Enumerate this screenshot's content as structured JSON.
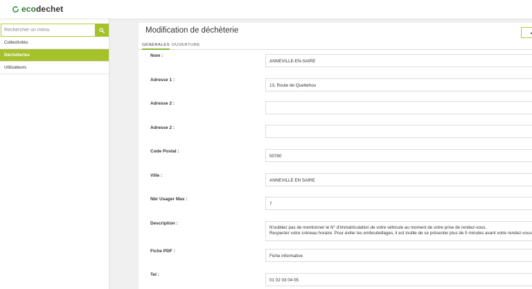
{
  "app": {
    "logo_prefix": "eco",
    "logo_suffix": "dechet",
    "accent": "#a6c22a",
    "logo_color": "#2d7a2d"
  },
  "sidebar": {
    "search_placeholder": "Rechercher un menu",
    "search_icon": "search-icon",
    "items": [
      {
        "label": "Collectivités",
        "active": false
      },
      {
        "label": "Déchèteries",
        "active": true
      },
      {
        "label": "Utilisateurs",
        "active": false
      }
    ]
  },
  "main": {
    "title": "Modification de déchèterie",
    "tabs": [
      {
        "label": "Générales",
        "active": true
      },
      {
        "label": "Ouverture",
        "active": false
      }
    ],
    "fields": [
      {
        "label": "Nom :",
        "value": "ANNEVILLE-EN-SAIRE"
      },
      {
        "label": "Adresse 1 :",
        "value": "13, Route de Quettehou"
      },
      {
        "label": "Adresse 2 :",
        "value": ""
      },
      {
        "label": "Adresse 2 :",
        "value": ""
      },
      {
        "label": "Code Postal :",
        "value": "50760"
      },
      {
        "label": "Ville :",
        "value": "ANNEVILLE EN SAIRE"
      },
      {
        "label": "Nbr Usager Max :",
        "value": "7"
      },
      {
        "label": "Description :",
        "value_line1": "N'oubliez pas de mentionner le N° d'immatriculation de votre véhicule au moment de votre prise de rendez-vous.",
        "value_line2": "Respecter votre créneau horaire. Pour éviter les embouteillages, il est inutile de se présenter plus de 5 minutes avant votre rendez-vous."
      },
      {
        "label": "Fiche PDF :",
        "value": "Fiche informative"
      },
      {
        "label": "Tel :",
        "value": "01 02 03 04 05"
      }
    ]
  }
}
